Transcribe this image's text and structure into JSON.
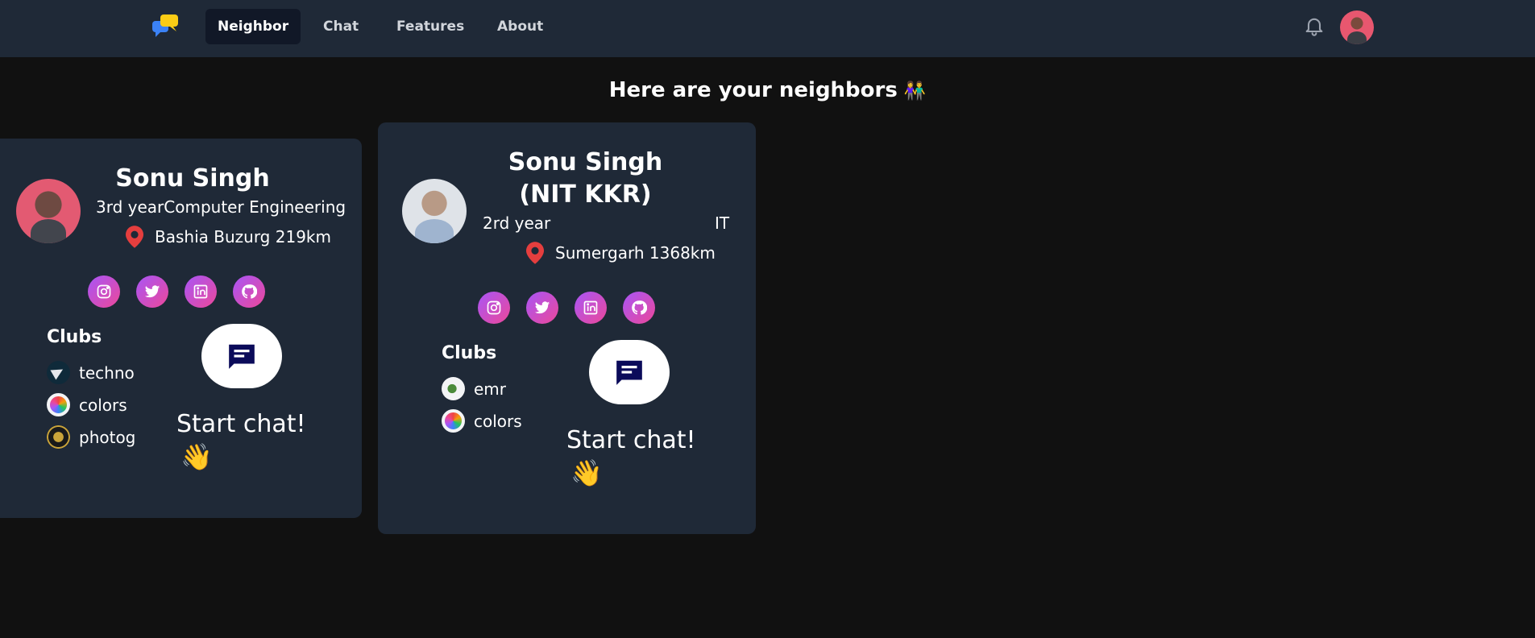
{
  "nav": {
    "logo_icon": "chat-bubbles-logo",
    "links": [
      {
        "label": "Neighbor",
        "active": true
      },
      {
        "label": "Chat",
        "active": false
      },
      {
        "label": "Features",
        "active": false
      },
      {
        "label": "About",
        "active": false
      }
    ],
    "bell_icon": "bell-icon",
    "avatar_icon": "user-avatar"
  },
  "heading": {
    "text": "Here are your neighbors",
    "emoji": "👫"
  },
  "cards": [
    {
      "name": "Sonu Singh",
      "year": "3rd year",
      "branch": "Computer Engineering",
      "location": "Bashia Buzurg",
      "distance": "219km",
      "socials": [
        "instagram-icon",
        "twitter-icon",
        "linkedin-icon",
        "github-icon"
      ],
      "clubs_title": "Clubs",
      "clubs": [
        "techno",
        "colors",
        "photog"
      ],
      "start_chat": "Start chat!",
      "wave": "👋"
    },
    {
      "name": "Sonu Singh (NIT KKR)",
      "year": "2rd year",
      "branch": "IT",
      "location": "Sumergarh",
      "distance": "1368km",
      "socials": [
        "instagram-icon",
        "twitter-icon",
        "linkedin-icon",
        "github-icon"
      ],
      "clubs_title": "Clubs",
      "clubs": [
        "emr",
        "colors"
      ],
      "start_chat": "Start chat!",
      "wave": "👋"
    }
  ],
  "colors": {
    "background": "#111111",
    "surface": "#1f2937",
    "social_gradient_start": "#a855f7",
    "social_gradient_end": "#ec4899",
    "chat_icon": "#0b0b5a",
    "pin": "#e53e3e"
  }
}
